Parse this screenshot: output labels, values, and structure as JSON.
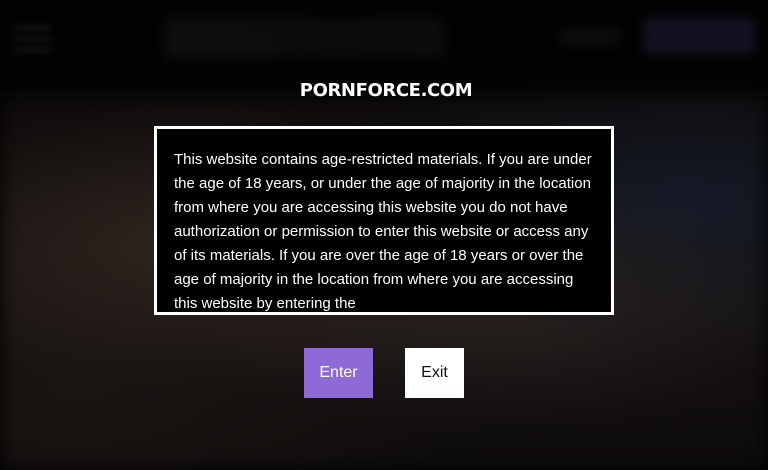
{
  "logo": {
    "text": "PORNFORCE.COM",
    "icon": "sword-shield-emblem-icon"
  },
  "notice": {
    "text": "This website contains age-restricted materials. If you are under the age of 18 years, or under the age of majority in the location from where you are accessing this website you do not have authorization or permission to enter this website or access any of its materials. If you are over the age of 18 years or over the age of majority in the location from where you are accessing this website by entering the"
  },
  "actions": {
    "enter_label": "Enter",
    "exit_label": "Exit"
  },
  "colors": {
    "accent": "#8d6ad6",
    "exit_bg": "#ffffff",
    "notice_border": "#ffffff"
  },
  "background": {
    "menu_icon": "hamburger-menu-icon"
  }
}
